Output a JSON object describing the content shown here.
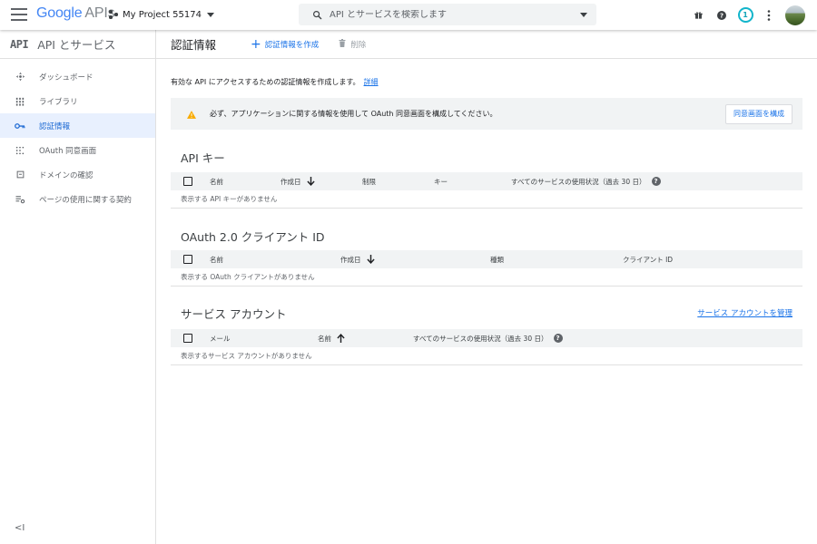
{
  "topbar": {
    "logo_google": "Google",
    "logo_apis": "APIs",
    "project_name": "My Project 55174",
    "search_placeholder": "API とサービスを検索します",
    "notification_count": "1"
  },
  "sidebar": {
    "logo": "API",
    "title": "API とサービス",
    "items": [
      {
        "label": "ダッシュボード",
        "icon": "dashboard-icon"
      },
      {
        "label": "ライブラリ",
        "icon": "library-icon"
      },
      {
        "label": "認証情報",
        "icon": "key-icon",
        "active": true
      },
      {
        "label": "OAuth 同意画面",
        "icon": "consent-icon"
      },
      {
        "label": "ドメインの確認",
        "icon": "domain-icon"
      },
      {
        "label": "ページの使用に関する契約",
        "icon": "agreements-icon"
      }
    ],
    "collapse_label": "<I"
  },
  "main": {
    "title": "認証情報",
    "create_label": "認証情報を作成",
    "delete_label": "削除",
    "intro_text": "有効な API にアクセスするための認証情報を作成します。",
    "intro_link": "詳細",
    "warning_text": "必ず、アプリケーションに関する情報を使用して OAuth 同意画面を構成してください。",
    "warning_button": "同意画面を構成"
  },
  "api_keys": {
    "title": "API キー",
    "columns": [
      "名前",
      "作成日",
      "制限",
      "キー",
      "すべてのサービスの使用状況（過去 30 日）"
    ],
    "empty": "表示する API キーがありません"
  },
  "oauth": {
    "title": "OAuth 2.0 クライアント ID",
    "columns": [
      "名前",
      "作成日",
      "種類",
      "クライアント ID"
    ],
    "empty": "表示する OAuth クライアントがありません"
  },
  "service_accounts": {
    "title": "サービス アカウント",
    "manage_link": "サービス アカウントを管理",
    "columns": [
      "メール",
      "名前",
      "すべてのサービスの使用状況（過去 30 日）"
    ],
    "empty": "表示するサービス アカウントがありません"
  },
  "colors": {
    "accent": "#1a73e8",
    "warning": "#f9ab00",
    "active_bg": "#e8f0fe"
  }
}
